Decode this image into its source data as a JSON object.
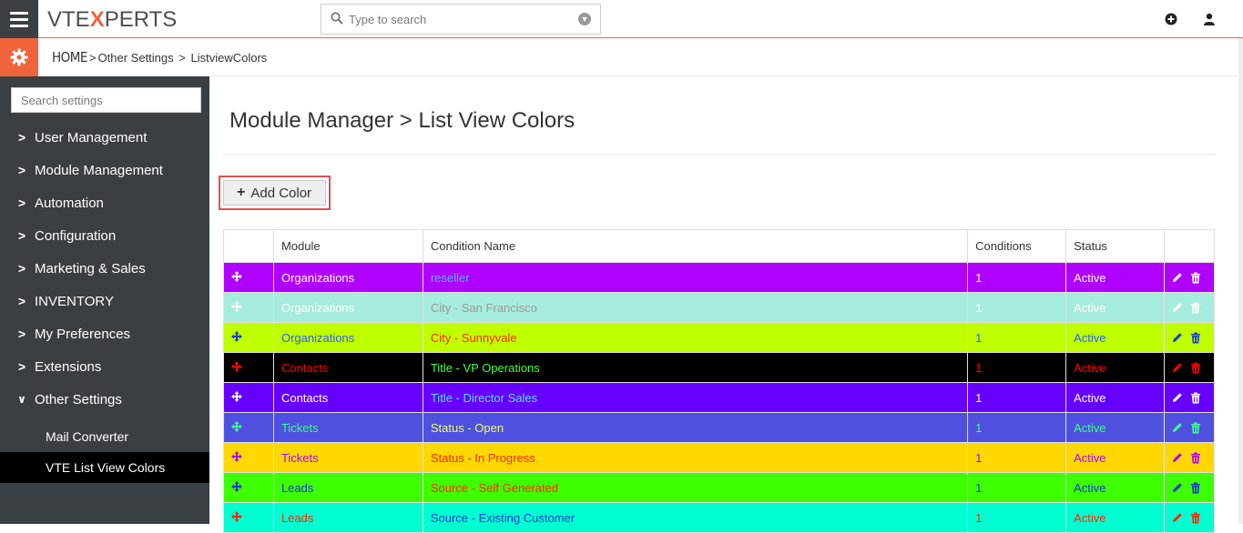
{
  "topbar": {
    "logo_pre": "VTE",
    "logo_x": "X",
    "logo_post": "PERTS",
    "search_placeholder": "Type to search"
  },
  "breadcrumb": {
    "home": "HOME",
    "level1": "Other Settings",
    "level2": "ListviewColors"
  },
  "sidebar": {
    "search_placeholder": "Search settings",
    "items": [
      {
        "label": "User Management"
      },
      {
        "label": "Module Management"
      },
      {
        "label": "Automation"
      },
      {
        "label": "Configuration"
      },
      {
        "label": "Marketing & Sales"
      },
      {
        "label": "INVENTORY"
      },
      {
        "label": "My Preferences"
      },
      {
        "label": "Extensions"
      },
      {
        "label": "Other Settings"
      }
    ],
    "subitems": [
      {
        "label": "Mail Converter"
      },
      {
        "label": "VTE List View Colors"
      }
    ]
  },
  "main": {
    "title": "Module Manager > List View Colors",
    "add_button": "Add Color",
    "columns": [
      "Module",
      "Condition Name",
      "Conditions",
      "Status"
    ],
    "rows": [
      {
        "module": "Organizations",
        "condition": "reseller",
        "count": "1",
        "status": "Active",
        "bg": "#b000ff",
        "fg": "#ffffff",
        "cond_fg": "#5ab4ff",
        "icon": "#ffffff"
      },
      {
        "module": "Organizations",
        "condition": "City - San Francisco",
        "count": "1",
        "status": "Active",
        "bg": "#a6ecdc",
        "fg": "#ffffff",
        "cond_fg": "#9a9a9a",
        "icon": "#ffffff"
      },
      {
        "module": "Organizations",
        "condition": "City - Sunnyvale",
        "count": "1",
        "status": "Active",
        "bg": "#bfff00",
        "fg": "#2f5bff",
        "cond_fg": "#ff2a00",
        "icon": "#1a3cd0"
      },
      {
        "module": "Contacts",
        "condition": "Title - VP Operations",
        "count": "1",
        "status": "Active",
        "bg": "#000000",
        "fg": "#ff0000",
        "cond_fg": "#3dff3d",
        "icon": "#ff0000"
      },
      {
        "module": "Contacts",
        "condition": "Title - Director Sales",
        "count": "1",
        "status": "Active",
        "bg": "#6600ff",
        "fg": "#ffffff",
        "cond_fg": "#5ae0ff",
        "icon": "#ffffff"
      },
      {
        "module": "Tickets",
        "condition": "Status - Open",
        "count": "1",
        "status": "Active",
        "bg": "#5050e0",
        "fg": "#3dff8a",
        "cond_fg": "#e8ff70",
        "icon": "#3dff8a"
      },
      {
        "module": "Tickets",
        "condition": "Status - In Progress",
        "count": "1",
        "status": "Active",
        "bg": "#ffd800",
        "fg": "#b000ff",
        "cond_fg": "#ff2a00",
        "icon": "#b000ff"
      },
      {
        "module": "Leads",
        "condition": "Source - Self Generated",
        "count": "1",
        "status": "Active",
        "bg": "#3dff00",
        "fg": "#1a3cd0",
        "cond_fg": "#ff2a00",
        "icon": "#1a3cd0"
      },
      {
        "module": "Leads",
        "condition": "Source - Existing Customer",
        "count": "1",
        "status": "Active",
        "bg": "#00ffd0",
        "fg": "#ff2a00",
        "cond_fg": "#1a3cd0",
        "icon": "#ff2a00"
      }
    ]
  }
}
